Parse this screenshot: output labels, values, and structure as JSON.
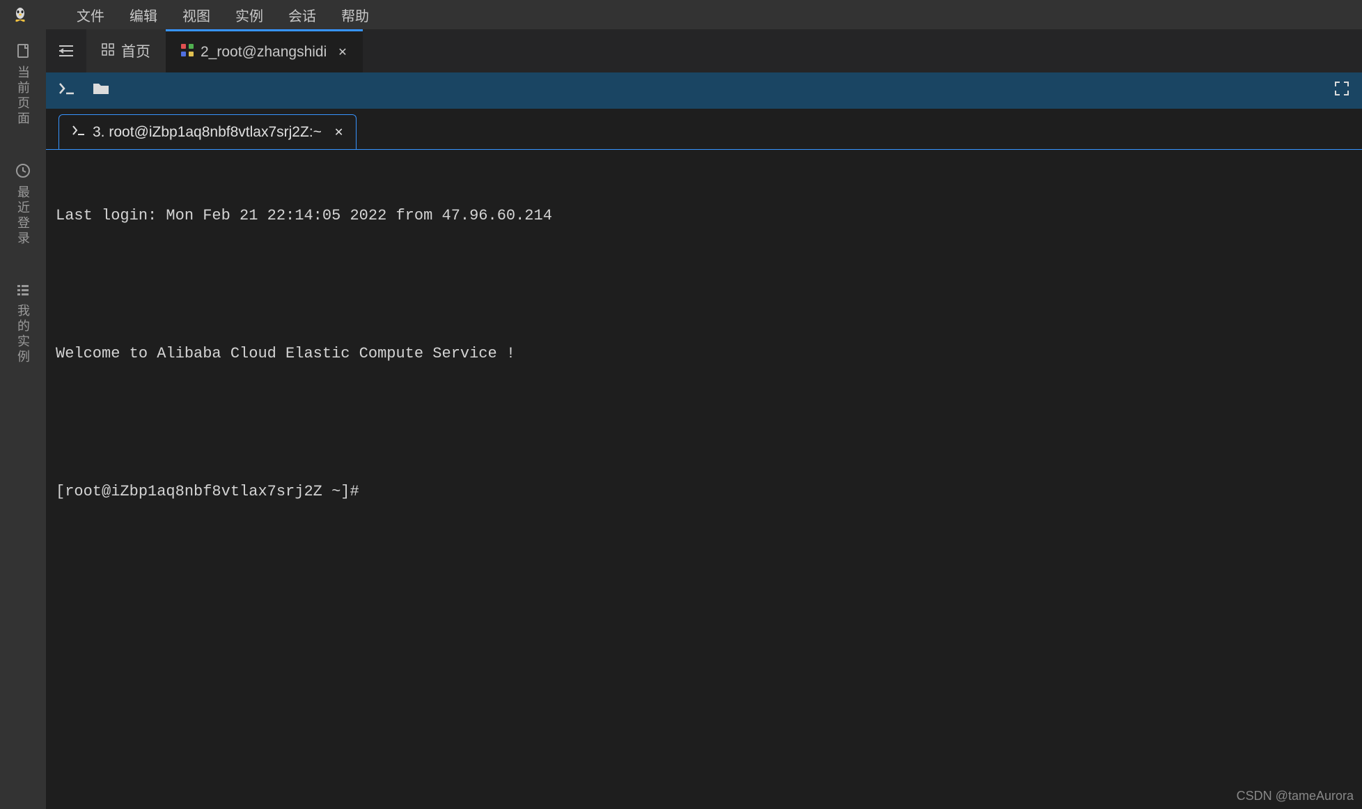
{
  "menubar": {
    "items": [
      "文件",
      "编辑",
      "视图",
      "实例",
      "会话",
      "帮助"
    ]
  },
  "sidebar": {
    "items": [
      {
        "icon": "page-icon",
        "label": "当前页面"
      },
      {
        "icon": "clock-icon",
        "label": "最近登录"
      },
      {
        "icon": "list-icon",
        "label": "我的实例"
      }
    ]
  },
  "tabs": {
    "home_label": "首页",
    "active": {
      "label": "2_root@zhangshidi"
    }
  },
  "session_tab": {
    "label": "3. root@iZbp1aq8nbf8vtlax7srj2Z:~"
  },
  "terminal": {
    "lines": [
      "Last login: Mon Feb 21 22:14:05 2022 from 47.96.60.214",
      "",
      "Welcome to Alibaba Cloud Elastic Compute Service !",
      "",
      "[root@iZbp1aq8nbf8vtlax7srj2Z ~]# "
    ]
  },
  "watermark": "CSDN @tameAurora"
}
